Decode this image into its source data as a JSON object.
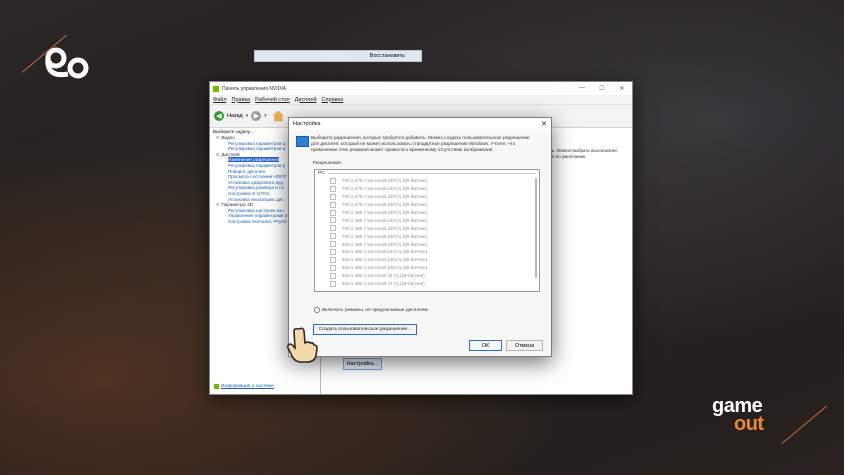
{
  "brand": {
    "bottom_logo_top": "game",
    "bottom_logo_bottom": "out"
  },
  "colors": {
    "accent_orange": "#e8892f",
    "nvidia_green": "#76b900",
    "link_blue": "#1a5fb4",
    "selection_blue": "#2563c9"
  },
  "window": {
    "title": "Панель управления NVIDIA",
    "menu": [
      "Файл",
      "Правка",
      "Рабочий стол",
      "Дисплей",
      "Справка"
    ],
    "toolbar": {
      "back_label": "Назад"
    },
    "task_title": "Выберите задачу...",
    "tree": [
      {
        "label": "Видео",
        "level": 0
      },
      {
        "label": "Регулировка параметров ц",
        "level": 1
      },
      {
        "label": "Регулировка параметров и",
        "level": 1
      },
      {
        "label": "Дисплей",
        "level": 0
      },
      {
        "label": "Изменение разрешения",
        "level": 1,
        "selected": true
      },
      {
        "label": "Регулировка параметров р",
        "level": 1
      },
      {
        "label": "Поворот дисплея",
        "level": 1
      },
      {
        "label": "Просмотр состояния HDCP",
        "level": 1
      },
      {
        "label": "Установка цифрового ауд",
        "level": 1
      },
      {
        "label": "Регулировка размера и по",
        "level": 1
      },
      {
        "label": "Настройка G-SYNC",
        "level": 1
      },
      {
        "label": "Установка нескольких дис",
        "level": 1
      },
      {
        "label": "Параметры 3D",
        "level": 0
      },
      {
        "label": "Регулировка настроек изо",
        "level": 1
      },
      {
        "label": "Управление параметрами 3",
        "level": 1
      },
      {
        "label": "Настройка Surround, PhysX",
        "level": 1
      }
    ],
    "sysinfo_link": "Информация о системе",
    "restore_label": "Восстановить",
    "right_text_1": "ь. Можно выбрать высококачес",
    "right_text_2": "е по умолчанию.",
    "nastroika_button": "Настройка..."
  },
  "dialog": {
    "title": "Настройка",
    "description": "Выберите разрешения, которые требуется добавить. Можно создать пользовательское разрешение для дисплея, который не может использовать стандартное разрешение Windows. Учтите, что применение этих режимов может привести к временному отсутствию изображения.",
    "resolutions_label": "Разрешения:",
    "group_label": "PC",
    "resolutions": [
      "720 x 576 с частотой 240 Гц (32-битное)",
      "720 x 576 с частотой 144 Гц (32-битное)",
      "720 x 576 с частотой 120 Гц (32-битное)",
      "720 x 576 с частотой 100 Гц (32-битное)",
      "720 x 480 с частотой 240 Гц (32-битное)",
      "720 x 480 с частотой 144 Гц (32-битное)",
      "720 x 480 с частотой 120 Гц (32-битное)",
      "720 x 480 с частотой 100 Гц (32-битное)",
      "640 x 480 с частотой 240 Гц (32-битное)",
      "640 x 480 с частотой 144 Гц (32-битное)",
      "640 x 480 с частотой 120 Гц (32-битное)",
      "640 x 480 с частотой 100 Гц (32-битное)",
      "640 x 480 с частотой 75 Гц (32-битное)",
      "640 x 480 с частотой 72 Гц (32-битное)"
    ],
    "enable_modes_label": "Включить режимы, не предлагаемые дисплеем",
    "create_custom_button": "Создать пользовательское разрешение...",
    "ok_button": "ОК",
    "cancel_button": "Отмена"
  }
}
